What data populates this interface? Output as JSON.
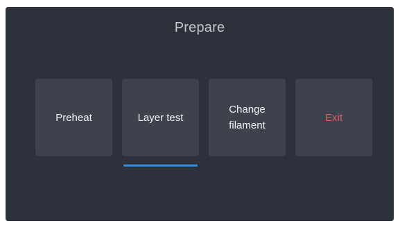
{
  "screen": {
    "title": "Prepare"
  },
  "buttons": [
    {
      "label": "Preheat"
    },
    {
      "label": "Layer test"
    },
    {
      "label": "Change\nfilament"
    },
    {
      "label": "Exit"
    }
  ],
  "selected_index": 1,
  "colors": {
    "background": "#2c313c",
    "button": "#3e424d",
    "text": "#f1f2f4",
    "title": "#c3c6cc",
    "exit_text": "#e05a60",
    "accent": "#2f8fe6"
  }
}
